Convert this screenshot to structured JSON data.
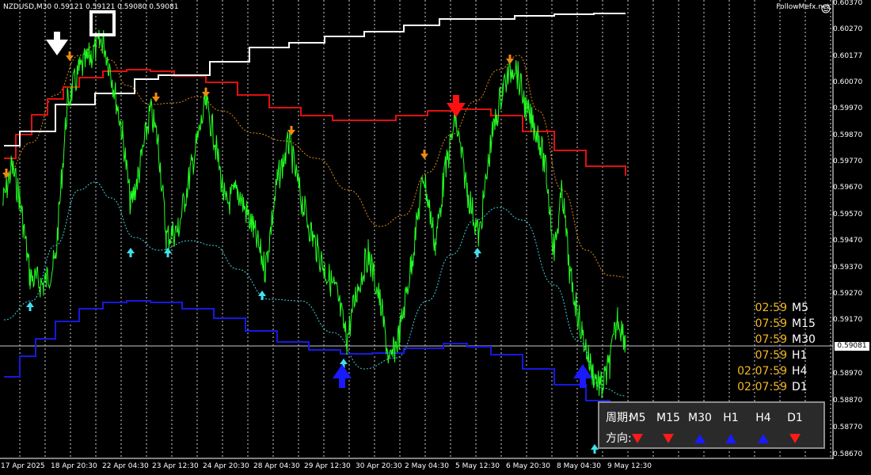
{
  "header": {
    "symbol_line": "NZDUSD,M30  0.59121 0.59121 0.59080 0.59081",
    "brand": "FollowMefx.net"
  },
  "price_axis": {
    "labels": [
      "0.60370",
      "0.60270",
      "0.60177",
      "0.60070",
      "0.59970",
      "0.59870",
      "0.59770",
      "0.59670",
      "0.59570",
      "0.59470",
      "0.59370",
      "0.59270",
      "0.59170",
      "0.59081",
      "0.58970",
      "0.58870",
      "0.58770",
      "0.58670"
    ],
    "current_price": "0.59081"
  },
  "time_axis": {
    "labels": [
      "17 Apr 2025",
      "18 Apr 20:30",
      "22 Apr 04:30",
      "23 Apr 12:30",
      "24 Apr 20:30",
      "28 Apr 04:30",
      "29 Apr 12:30",
      "30 Apr 20:30",
      "2 May 04:30",
      "5 May 12:30",
      "6 May 20:30",
      "8 May 04:30",
      "9 May 12:30"
    ]
  },
  "timers": [
    {
      "time": "02:59",
      "period": "M5"
    },
    {
      "time": "07:59",
      "period": "M15"
    },
    {
      "time": "07:59",
      "period": "M30"
    },
    {
      "time": "07:59",
      "period": "H1"
    },
    {
      "time": "02:07:59",
      "period": "H4"
    },
    {
      "time": "02:07:59",
      "period": "D1"
    }
  ],
  "direction_panel": {
    "period_label": "周期:",
    "direction_label": "方向:",
    "periods": [
      "M5",
      "M15",
      "M30",
      "H1",
      "H4",
      "D1"
    ],
    "directions": [
      "down",
      "down",
      "up",
      "up",
      "up",
      "down"
    ]
  },
  "colors": {
    "background": "#000000",
    "price_line": "#22ff22",
    "upper_ma": "#e01010",
    "lower_ma": "#1818e0",
    "step_line": "#ffffff",
    "orange_band": "#e08a10",
    "cyan_band": "#40d0d8",
    "timer_text": "#f5b820"
  }
}
